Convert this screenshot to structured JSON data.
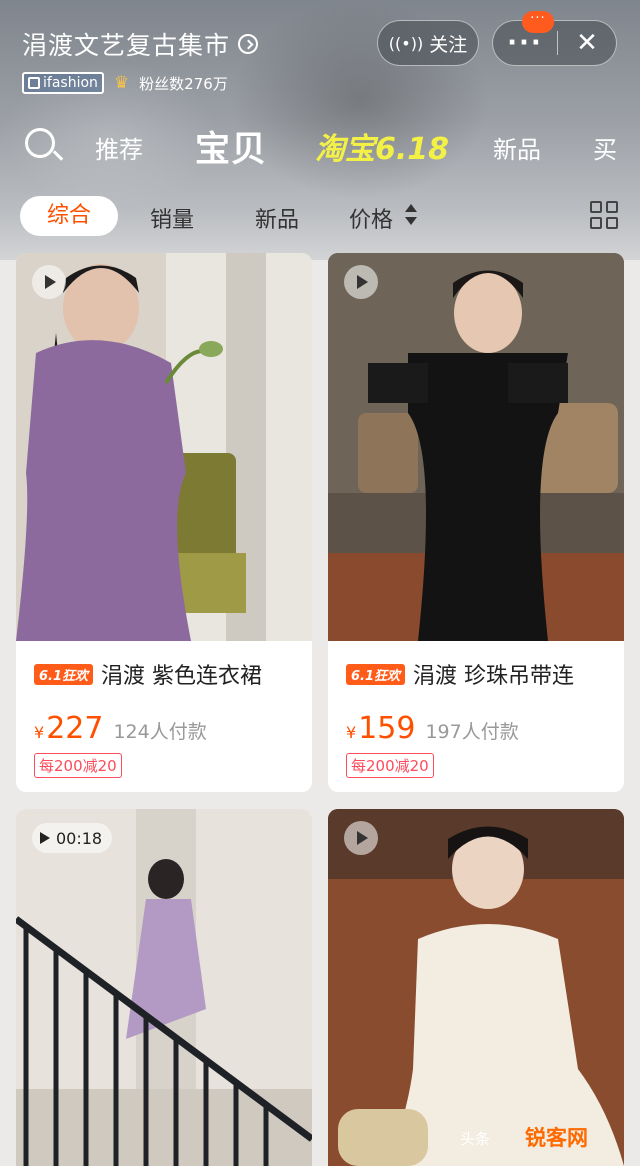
{
  "header": {
    "shop_name": "涓渡文艺复古集市",
    "brand_badge": "ifashion",
    "fans": "粉丝数276万",
    "follow_label": "关注",
    "notification_badge": "···"
  },
  "nav": {
    "tabs": [
      "推荐",
      "宝贝",
      "淘宝6.18",
      "新品",
      "买"
    ],
    "active": "宝贝"
  },
  "filters": {
    "items": [
      "综合",
      "销量",
      "新品",
      "价格"
    ],
    "active": "综合"
  },
  "products": [
    {
      "tag": "6.1狂欢",
      "title": "涓渡 紫色连衣裙",
      "currency": "¥",
      "price": "227",
      "sold": "124人付款",
      "coupon": "每200减20"
    },
    {
      "tag": "6.1狂欢",
      "title": "涓渡 珍珠吊带连",
      "currency": "¥",
      "price": "159",
      "sold": "197人付款",
      "coupon": "每200减20"
    },
    {
      "video_duration": "00:18"
    },
    {}
  ],
  "watermark": {
    "source": "头条",
    "site": "锐客网"
  },
  "colors": {
    "accent": "#ff5000",
    "coupon": "#ff4b5c",
    "promo_yellow": "#f3f146"
  }
}
